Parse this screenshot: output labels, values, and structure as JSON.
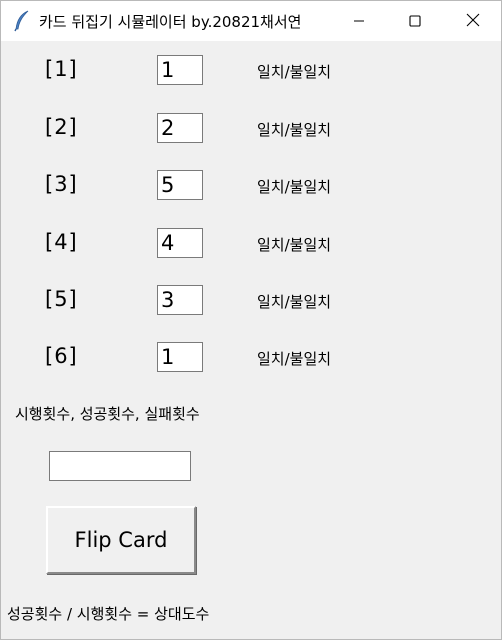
{
  "window": {
    "title": "카드 뒤집기 시뮬레이터 by.20821채서연"
  },
  "rows": [
    {
      "label": "[1]",
      "value": "1",
      "status": "일치/불일치"
    },
    {
      "label": "[2]",
      "value": "2",
      "status": "일치/불일치"
    },
    {
      "label": "[3]",
      "value": "5",
      "status": "일치/불일치"
    },
    {
      "label": "[4]",
      "value": "4",
      "status": "일치/불일치"
    },
    {
      "label": "[5]",
      "value": "3",
      "status": "일치/불일치"
    },
    {
      "label": "[6]",
      "value": "1",
      "status": "일치/불일치"
    }
  ],
  "stats": {
    "label": "시행횟수, 성공횟수, 실패횟수",
    "value": ""
  },
  "flip_button": {
    "label": "Flip Card"
  },
  "result": {
    "label": "성공횟수 / 시행횟수 = 상대도수"
  },
  "icons": {
    "app": "feather-icon",
    "minimize": "minimize-icon",
    "maximize": "maximize-icon",
    "close": "close-icon"
  }
}
